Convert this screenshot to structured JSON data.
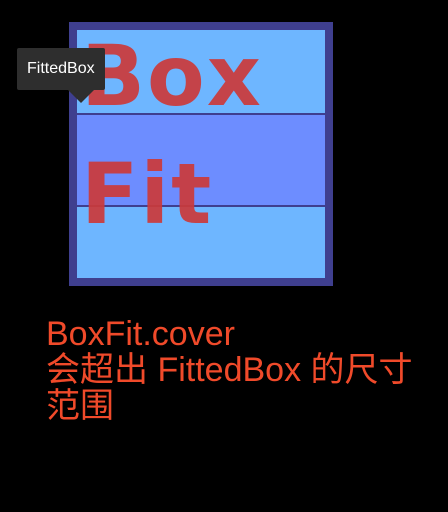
{
  "tooltip": {
    "text": "FittedBox"
  },
  "fitted_box": {
    "line1": "Box",
    "line2": "Fit"
  },
  "caption": {
    "line1": "BoxFit.cover",
    "line2": "会超出 FittedBox 的尺寸",
    "line3": "范围"
  },
  "colors": {
    "background": "#000000",
    "border": "#3f3f8f",
    "box_fill": "#6eb6ff",
    "band_fill": "#6d8dff",
    "box_text": "#cc3a3a",
    "caption_text": "#f04a2a",
    "tooltip_bg": "#2e2e2e"
  }
}
